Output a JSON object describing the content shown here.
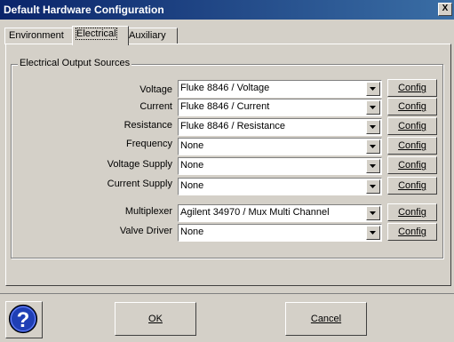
{
  "window": {
    "title": "Default Hardware Configuration",
    "close_label": "X"
  },
  "tabs": [
    {
      "label": "Environment",
      "active": false
    },
    {
      "label": "Electrical",
      "active": true
    },
    {
      "label": "Auxiliary",
      "active": false
    }
  ],
  "group": {
    "label": "Electrical Output Sources"
  },
  "rows": [
    {
      "label": "Voltage",
      "value": "Fluke 8846 / Voltage",
      "button": "Config"
    },
    {
      "label": "Current",
      "value": "Fluke 8846 / Current",
      "button": "Config"
    },
    {
      "label": "Resistance",
      "value": "Fluke 8846 / Resistance",
      "button": "Config"
    },
    {
      "label": "Frequency",
      "value": "None",
      "button": "Config"
    },
    {
      "label": "Voltage Supply",
      "value": "None",
      "button": "Config"
    },
    {
      "label": "Current Supply",
      "value": "None",
      "button": "Config"
    },
    {
      "label": "Multiplexer",
      "value": "Agilent 34970 / Mux Multi Channel",
      "button": "Config"
    },
    {
      "label": "Valve Driver",
      "value": "None",
      "button": "Config"
    }
  ],
  "buttons": {
    "ok": "OK",
    "cancel": "Cancel"
  },
  "colors": {
    "titlebar_start": "#0a246a",
    "titlebar_end": "#3a6ea5",
    "face": "#d4d0c8",
    "help_icon": "#1f3fb5"
  }
}
